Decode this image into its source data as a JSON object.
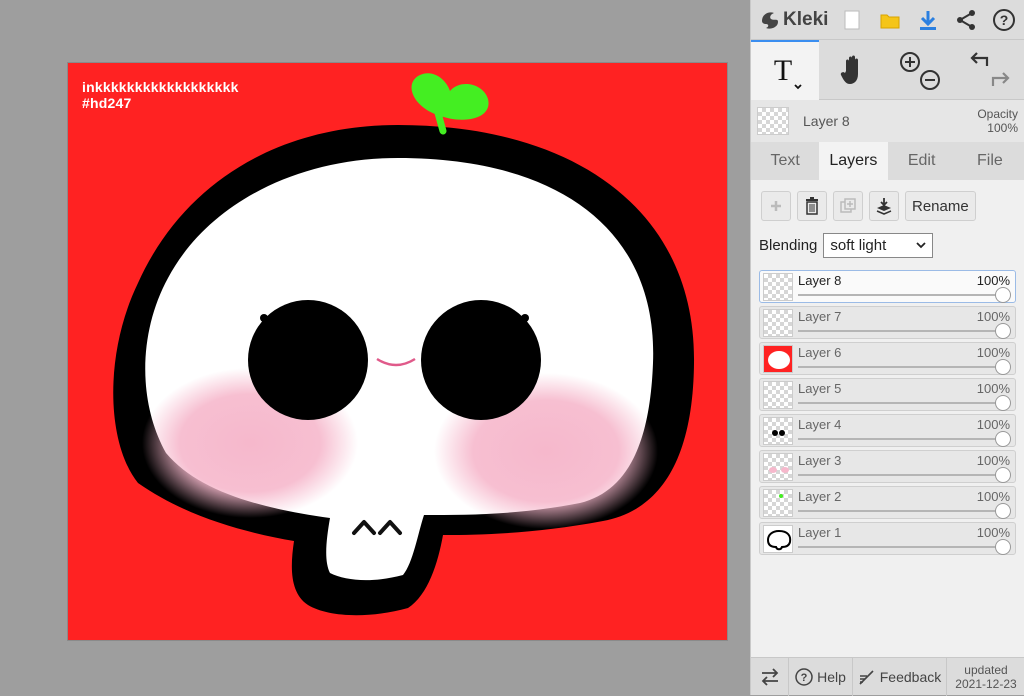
{
  "canvas": {
    "caption_line1": "inkkkkkkkkkkkkkkkkkk",
    "caption_line2": "#hd247",
    "background_color": "#ff2222"
  },
  "header": {
    "app_name": "Kleki",
    "icons": [
      "kleki-logo-icon",
      "new-file-icon",
      "open-folder-icon",
      "download-icon",
      "share-icon",
      "help-icon"
    ]
  },
  "tools": {
    "active_tool": "T",
    "items": [
      "text-tool-icon",
      "hand-tool-icon",
      "zoom-in-icon",
      "zoom-out-icon",
      "undo-icon",
      "redo-icon"
    ]
  },
  "current_layer": {
    "name": "Layer 8",
    "opacity_label": "Opacity",
    "opacity_value": "100%"
  },
  "tabs": [
    "Text",
    "Layers",
    "Edit",
    "File"
  ],
  "active_tab": "Layers",
  "layer_actions": {
    "rename_label": "Rename"
  },
  "blending": {
    "label": "Blending",
    "value": "soft light"
  },
  "layers": [
    {
      "name": "Layer 8",
      "opacity": "100%",
      "thumb": "empty"
    },
    {
      "name": "Layer 7",
      "opacity": "100%",
      "thumb": "empty"
    },
    {
      "name": "Layer 6",
      "opacity": "100%",
      "thumb": "red-white"
    },
    {
      "name": "Layer 5",
      "opacity": "100%",
      "thumb": "empty"
    },
    {
      "name": "Layer 4",
      "opacity": "100%",
      "thumb": "eyes"
    },
    {
      "name": "Layer 3",
      "opacity": "100%",
      "thumb": "blush"
    },
    {
      "name": "Layer 2",
      "opacity": "100%",
      "thumb": "sprout"
    },
    {
      "name": "Layer 1",
      "opacity": "100%",
      "thumb": "outline"
    }
  ],
  "footer": {
    "help_label": "Help",
    "feedback_label": "Feedback",
    "updated_label": "updated",
    "updated_date": "2021-12-23"
  },
  "colors": {
    "accent": "#3a8ef0",
    "sprout": "#44ee22",
    "blush": "#f6b8cc",
    "smile": "#e05a8a"
  }
}
